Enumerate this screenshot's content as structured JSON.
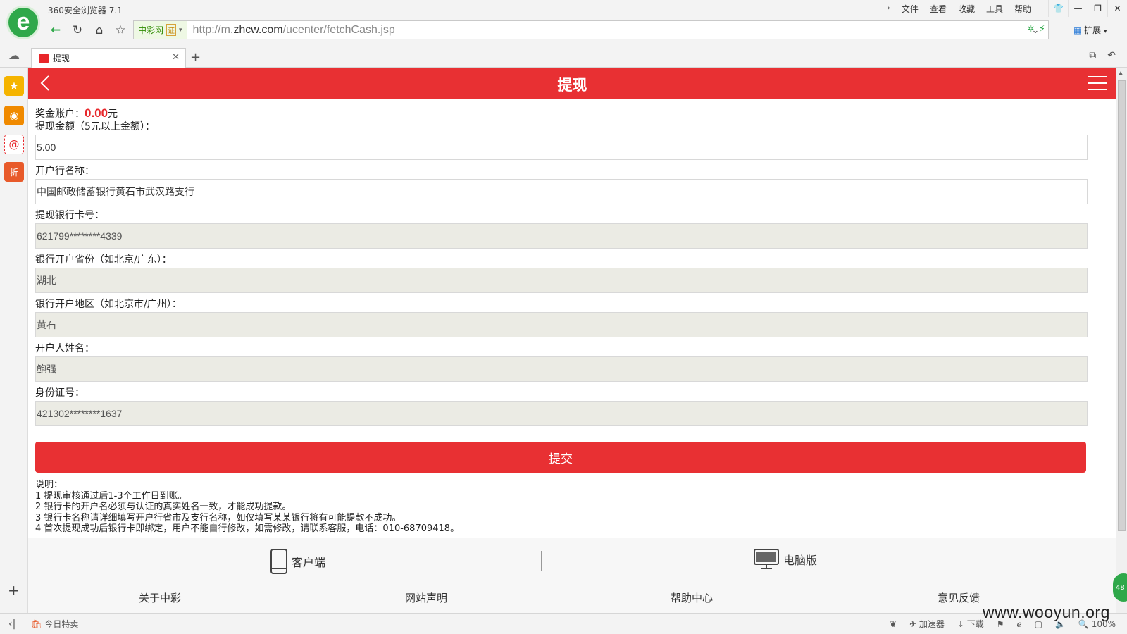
{
  "browser": {
    "app_title": "360安全浏览器 7.1",
    "menus": [
      "文件",
      "查看",
      "收藏",
      "工具",
      "帮助"
    ],
    "cert_name": "中彩网",
    "cert_badge": "证",
    "url_prefix": "http://m.",
    "url_domain": "zhcw.com",
    "url_path": "/ucenter/fetchCash.jsp",
    "extensions_label": "扩展",
    "tab_title": "提现"
  },
  "page": {
    "header_title": "提现",
    "balance_label": "奖金账户：",
    "balance_amount": "0.00",
    "balance_unit": "元",
    "fields": [
      {
        "label": "提现金额（5元以上金额）：",
        "value": "5.00"
      },
      {
        "label": "开户行名称：",
        "value": "中国邮政储蓄银行黄石市武汉路支行"
      },
      {
        "label": "提现银行卡号：",
        "value": "621799********4339"
      },
      {
        "label": "银行开户省份（如北京/广东）：",
        "value": "湖北"
      },
      {
        "label": "银行开户地区（如北京市/广州）：",
        "value": "黄石"
      },
      {
        "label": "开户人姓名：",
        "value": "鲍强"
      },
      {
        "label": "身份证号：",
        "value": "421302********1637"
      }
    ],
    "submit_label": "提交",
    "notes_title": "说明：",
    "notes": [
      "1 提现审核通过后1-3个工作日到账。",
      "2 银行卡的开户名必须与认证的真实姓名一致，才能成功提款。",
      "3 银行卡名称请详细填写开户行省市及支行名称，如仅填写某某银行将有可能提款不成功。",
      "4 首次提现成功后银行卡即绑定，用户不能自行修改，如需修改，请联系客服，电话：010-68709418。"
    ],
    "footer": {
      "client_label": "客户端",
      "pc_label": "电脑版",
      "links": [
        "关于中彩",
        "网站声明",
        "帮助中心",
        "意见反馈"
      ]
    }
  },
  "statusbar": {
    "deals": "今日特卖",
    "accelerator": "加速器",
    "download": "下载",
    "zoom": "100%",
    "badge": "48"
  },
  "watermark": "www.wooyun.org",
  "colors": {
    "brand_red": "#e83033",
    "browser_green": "#2fa84a"
  }
}
